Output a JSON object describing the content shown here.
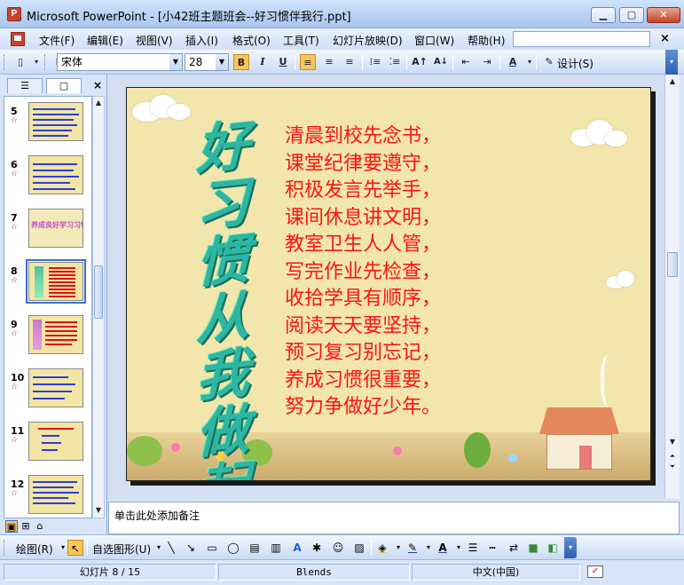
{
  "window": {
    "app_icon": "powerpoint-icon",
    "app_icon_glyph": "P",
    "title": "Microsoft PowerPoint - [小42班主题班会--好习惯伴我行.ppt]",
    "minimize_glyph": "▁",
    "restore_glyph": "▢",
    "close_glyph": "✕"
  },
  "menu": {
    "items": [
      "文件(F)",
      "编辑(E)",
      "视图(V)",
      "插入(I)",
      "格式(O)",
      "工具(T)",
      "幻灯片放映(D)",
      "窗口(W)",
      "帮助(H)"
    ],
    "close_doc_glyph": "×"
  },
  "toolbar": {
    "font_name": "宋体",
    "font_size": "28",
    "bold": "B",
    "italic": "I",
    "underline": "U",
    "design_label": "设计(S)",
    "align_left_active": true,
    "accent": "#f6c55b"
  },
  "left_panel": {
    "tab_outline_glyph": "☰",
    "tab_slides_glyph": "▢",
    "close_glyph": "×",
    "slides": [
      {
        "number": "5"
      },
      {
        "number": "6"
      },
      {
        "number": "7",
        "thumb_text": "养成良好学习习惯"
      },
      {
        "number": "8",
        "selected": true
      },
      {
        "number": "9"
      },
      {
        "number": "10"
      },
      {
        "number": "11"
      },
      {
        "number": "12"
      }
    ],
    "star_glyph": "☆",
    "view_buttons": [
      "normal-view-icon",
      "slide-sorter-icon",
      "slideshow-icon"
    ]
  },
  "slide": {
    "vertical_title": "好习惯从我做起！",
    "poem": [
      "清晨到校先念书，",
      "课堂纪律要遵守，",
      "积极发言先举手，",
      "课间休息讲文明，",
      "教室卫生人人管，",
      "写完作业先检查，",
      "收拾学具有顺序，",
      "阅读天天要坚持，",
      "预习复习别忘记，",
      "养成习惯很重要，",
      "努力争做好少年。"
    ],
    "text_color": "#ff1212",
    "background_color": "#f2e6ad"
  },
  "notes": {
    "placeholder": "单击此处添加备注"
  },
  "drawbar": {
    "draw_label": "绘图(R)",
    "autoshapes_label": "自选图形(U)"
  },
  "status": {
    "slide_position": "幻灯片 8 / 15",
    "design_name": "Blends",
    "language": "中文(中国)"
  }
}
